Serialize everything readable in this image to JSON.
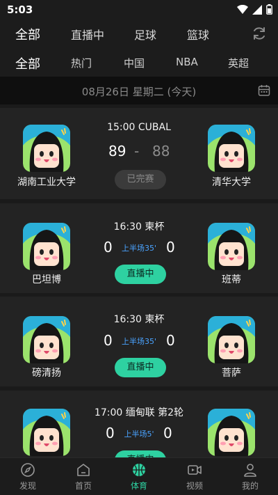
{
  "status": {
    "time": "5:03"
  },
  "tabs_primary": [
    "全部",
    "直播中",
    "足球",
    "篮球"
  ],
  "tabs_secondary": [
    "全部",
    "热门",
    "中国",
    "NBA",
    "英超"
  ],
  "date_label": "08月26日 星期二   (今天)",
  "matches": [
    {
      "meta": "15:00 CUBAL",
      "home": "湖南工业大学",
      "away": "清华大学",
      "home_score": "89",
      "away_score": "88",
      "separator": "-",
      "button": "已完赛"
    },
    {
      "meta": "16:30 柬杯",
      "home": "巴坦博",
      "away": "班蒂",
      "home_score": "0",
      "away_score": "0",
      "phase": "上半场35'",
      "button": "直播中"
    },
    {
      "meta": "16:30 柬杯",
      "home": "磅清扬",
      "away": "菩萨",
      "home_score": "0",
      "away_score": "0",
      "phase": "上半场35'",
      "button": "直播中"
    },
    {
      "meta": "17:00 缅甸联 第2轮",
      "home": "",
      "away": "",
      "home_score": "0",
      "away_score": "0",
      "phase": "上半场5'",
      "button": "直播中"
    }
  ],
  "bottom_nav": [
    {
      "label": "发现",
      "icon": "compass-icon"
    },
    {
      "label": "首页",
      "icon": "home-icon"
    },
    {
      "label": "体育",
      "icon": "basketball-icon"
    },
    {
      "label": "视频",
      "icon": "video-icon"
    },
    {
      "label": "我的",
      "icon": "person-icon"
    }
  ],
  "colors": {
    "accent": "#2ed1a1",
    "phase": "#4aa3ff",
    "background": "#1a1a1a",
    "card": "#232323"
  }
}
